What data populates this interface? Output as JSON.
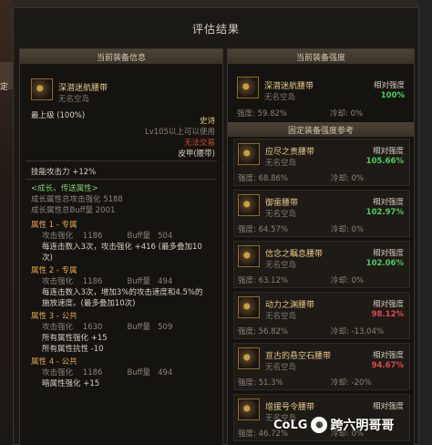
{
  "background": {
    "left_char": "定",
    "top_char": "F"
  },
  "dialog": {
    "title": "评估结果"
  },
  "left_panel": {
    "header": "当前装备信息",
    "item": {
      "name": "深潜迷航腰带",
      "sub": "无名空岛"
    },
    "grade": "最上级 (100%)",
    "rarity": "史诗",
    "level_req": "Lv105以上可以使用",
    "trade": "无法交易",
    "type": "皮甲(腰带)",
    "skill_attack": "技能攻击力  +12%",
    "growth_title": "<成长、传送属性>",
    "growth_attack": "成长属性总攻击强化 5188",
    "growth_buff": "成长属性总Buff量 2001",
    "attributes": [
      {
        "title": "属性 1 - 专属",
        "stat_line": "攻击强化    1186          Buff量   504",
        "desc": [
          "每连击数入3次，攻击强化 +416 (最多叠加10",
          "次)"
        ]
      },
      {
        "title": "属性 2 - 专属",
        "stat_line": "攻击强化    1186          Buff量   494",
        "desc": [
          "每连击数入3次，增加3%的攻击速度和4.5%的",
          "施放速度。(最多叠加10次)"
        ]
      },
      {
        "title": "属性 3 - 公共",
        "stat_line": "攻击强化    1630          Buff量   509",
        "desc": [
          "所有属性强化 +15",
          "所有属性抗性 -10"
        ]
      },
      {
        "title": "属性 4 - 公共",
        "stat_line": "攻击强化    1186          Buff量   494",
        "desc": [
          "暗属性强化 +15"
        ]
      }
    ]
  },
  "right_panel": {
    "header": "当前装备强度",
    "current": {
      "name": "深潜迷航腰带",
      "sub": "无名空岛",
      "rel_label": "相对强度",
      "rel_value": "100%",
      "strength": "强度: 59.82%",
      "cooldown": "冷却: 0%"
    },
    "ref_header": "固定装备强度参考",
    "refs": [
      {
        "name": "应尽之责腰带",
        "sub": "无名空岛",
        "rel_label": "相对强度",
        "rel_value": "105.66%",
        "positive": true,
        "strength": "强度: 68.86%",
        "cooldown": "冷却: 0%"
      },
      {
        "name": "御雷腰带",
        "sub": "无名空岛",
        "rel_label": "相对强度",
        "rel_value": "102.97%",
        "positive": true,
        "strength": "强度: 64.57%",
        "cooldown": "冷却: 0%"
      },
      {
        "name": "信念之瞩息腰带",
        "sub": "无名空岛",
        "rel_label": "相对强度",
        "rel_value": "102.06%",
        "positive": true,
        "strength": "强度: 63.12%",
        "cooldown": "冷却: 0%"
      },
      {
        "name": "动力之渊腰带",
        "sub": "无名空岛",
        "rel_label": "相对强度",
        "rel_value": "98.12%",
        "positive": false,
        "strength": "强度: 56.82%",
        "cooldown": "冷却: -13.04%"
      },
      {
        "name": "亘古的悬空石腰带",
        "sub": "无名空岛",
        "rel_label": "相对强度",
        "rel_value": "94.67%",
        "positive": false,
        "strength": "强度: 51.3%",
        "cooldown": "冷却: -20%"
      },
      {
        "name": "增援号令腰带",
        "sub": "无名空岛",
        "rel_label": "相对强度",
        "rel_value": "",
        "positive": true,
        "strength": "强度: 46.72%",
        "cooldown": "冷却: 0%"
      }
    ]
  },
  "watermark": {
    "logo": "CoLG",
    "text": "跨六明哥哥"
  }
}
